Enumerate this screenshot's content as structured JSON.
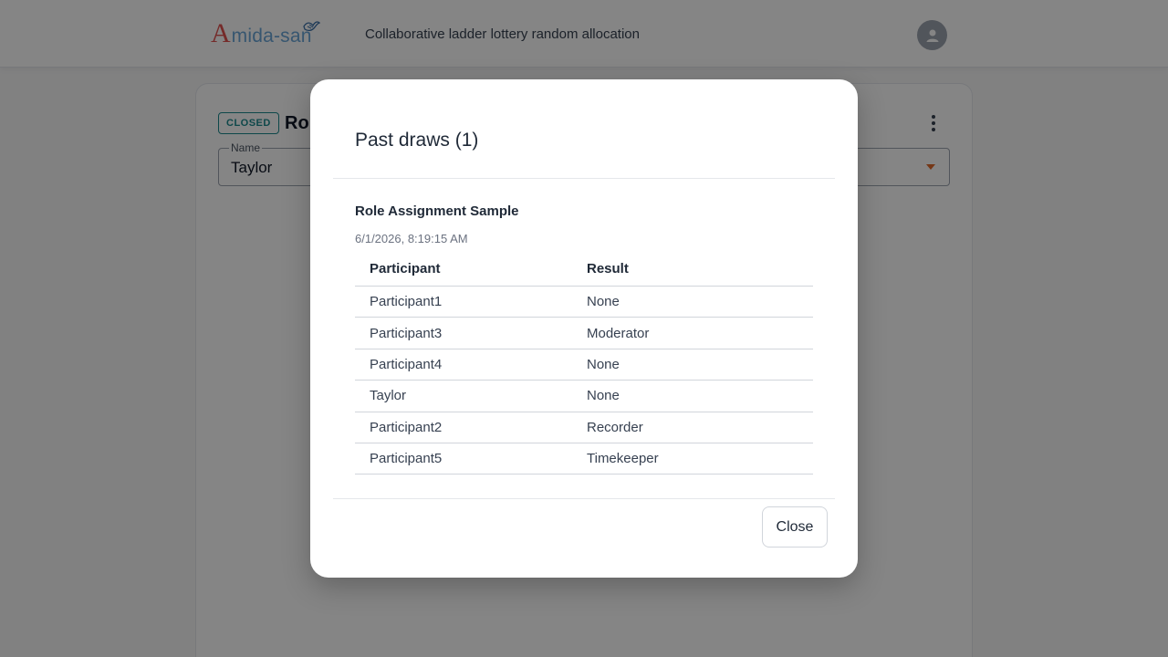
{
  "header": {
    "logo_first": "A",
    "logo_rest": "mida-san",
    "tagline": "Collaborative ladder lottery random allocation"
  },
  "card": {
    "status_badge": "CLOSED",
    "title_visible": "Rol",
    "name_label": "Name",
    "name_value": "Taylor"
  },
  "modal": {
    "title": "Past draws (1)",
    "draw_title": "Role Assignment Sample",
    "draw_date": "6/1/2026, 8:19:15 AM",
    "columns": [
      "Participant",
      "Result"
    ],
    "rows": [
      [
        "Participant1",
        "None"
      ],
      [
        "Participant3",
        "Moderator"
      ],
      [
        "Participant4",
        "None"
      ],
      [
        "Taylor",
        "None"
      ],
      [
        "Participant2",
        "Recorder"
      ],
      [
        "Participant5",
        "Timekeeper"
      ]
    ],
    "close_label": "Close"
  },
  "colors": {
    "badge": "#1c8a8f",
    "logo_red": "#e0524f",
    "logo_blue": "#6aa6d6",
    "caret": "#e06a2b"
  },
  "icons": [
    "bird-logo-icon",
    "user-avatar-icon",
    "more-vert-icon",
    "dropdown-caret-icon"
  ]
}
